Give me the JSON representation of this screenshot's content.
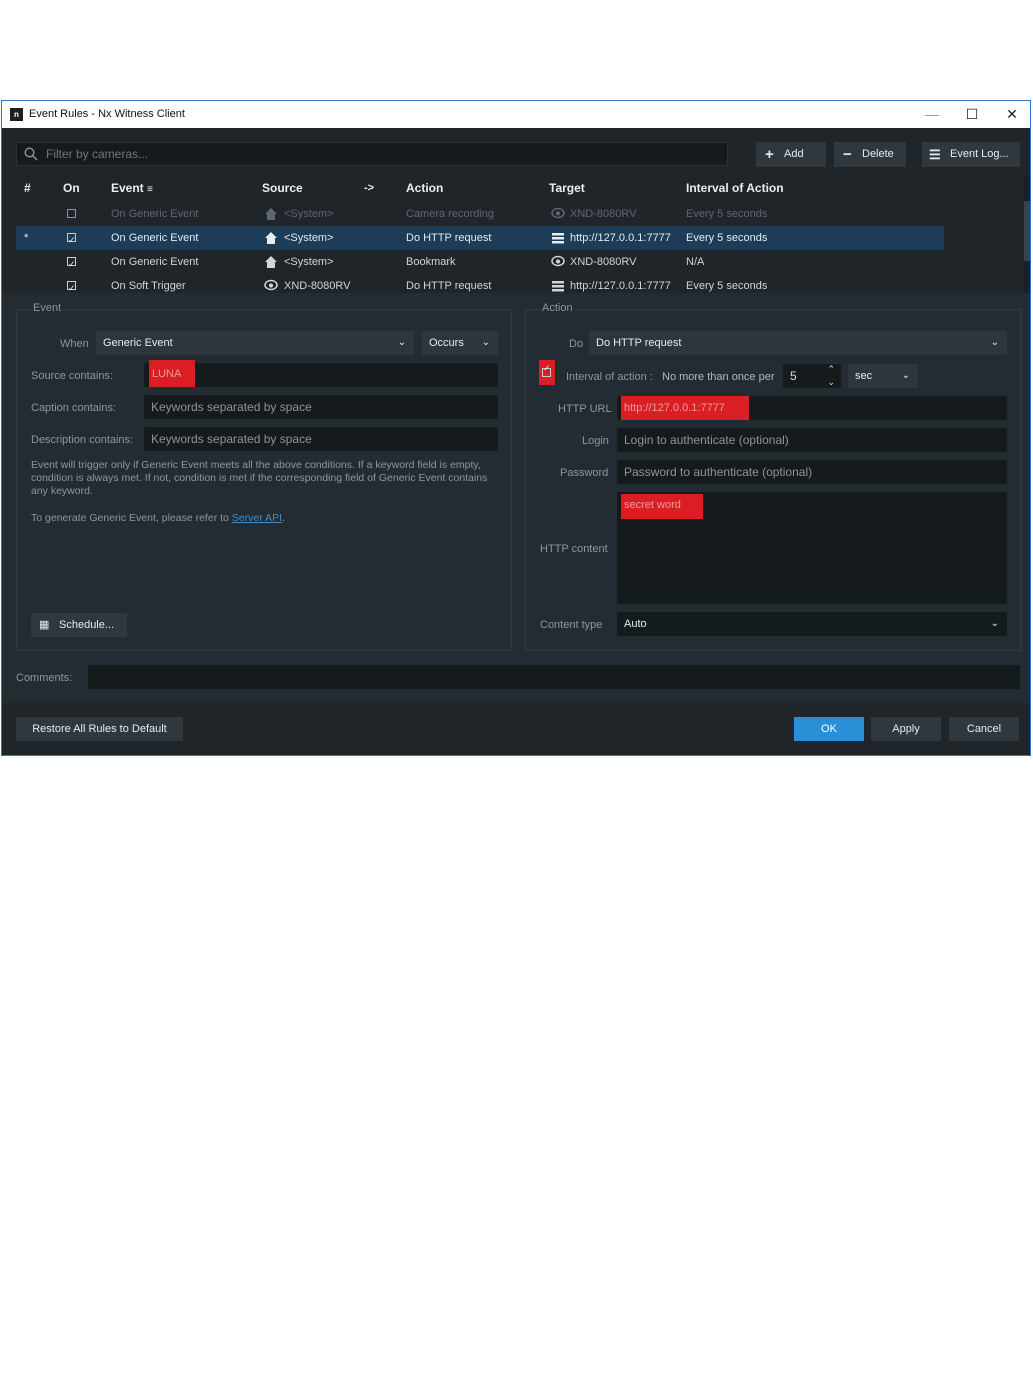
{
  "window": {
    "title": "Event Rules - Nx Witness Client",
    "app_icon_glyph": "n",
    "controls": {
      "minimize": "—",
      "maximize": "☐",
      "close": "✕"
    }
  },
  "toolbar": {
    "search_placeholder": "Filter by cameras...",
    "add_label": "Add",
    "delete_label": "Delete",
    "event_log_label": "Event Log..."
  },
  "table": {
    "headers": {
      "num": "#",
      "on": "On",
      "event": "Event",
      "source": "Source",
      "arrow": "->",
      "action": "Action",
      "target": "Target",
      "interval": "Interval of Action"
    },
    "rows": [
      {
        "num": "",
        "on": false,
        "event": "On Generic Event",
        "source": "<System>",
        "action": "Camera recording",
        "target": "XND-8080RV",
        "interval": "Every 5 seconds",
        "source_icon": "home-icon",
        "target_icon": "camera-icon"
      },
      {
        "num": "*",
        "on": true,
        "event": "On Generic Event",
        "source": "<System>",
        "action": "Do HTTP request",
        "target": "http://127.0.0.1:7777",
        "interval": "Every 5 seconds",
        "source_icon": "home-icon",
        "target_icon": "server-icon"
      },
      {
        "num": "",
        "on": true,
        "event": "On Generic Event",
        "source": "<System>",
        "action": "Bookmark",
        "target": "XND-8080RV",
        "interval": "N/A",
        "source_icon": "home-icon",
        "target_icon": "camera-icon"
      },
      {
        "num": "",
        "on": true,
        "event": "On Soft Trigger",
        "source": "XND-8080RV",
        "action": "Do HTTP request",
        "target": "http://127.0.0.1:7777",
        "interval": "Every 5 seconds",
        "source_icon": "camera-icon",
        "target_icon": "server-icon"
      }
    ]
  },
  "event_panel": {
    "title": "Event",
    "when_label": "When",
    "when_value": "Generic Event",
    "occurs_value": "Occurs",
    "source_label": "Source contains:",
    "source_value": "LUNA",
    "caption_label": "Caption contains:",
    "caption_placeholder": "Keywords separated by space",
    "description_label": "Description contains:",
    "description_placeholder": "Keywords separated by space",
    "note": "Event will trigger only if Generic Event meets all the above conditions. If a keyword field is empty, condition is always met. If not, condition is met if the corresponding field of Generic Event contains any keyword.",
    "refer_text": "To generate Generic Event, please refer to",
    "refer_link": "Server API",
    "refer_suffix": ".",
    "schedule_label": "Schedule..."
  },
  "action_panel": {
    "title": "Action",
    "do_label": "Do",
    "do_value": "Do HTTP request",
    "interval_label": "Interval of action :",
    "interval_desc": "No more than once per",
    "interval_value": "5",
    "interval_unit": "sec",
    "url_label": "HTTP URL",
    "url_value": "http://127.0.0.1:7777",
    "login_label": "Login",
    "login_placeholder": "Login to authenticate (optional)",
    "password_label": "Password",
    "password_placeholder": "Password to authenticate (optional)",
    "content_label": "HTTP content",
    "content_value": "secret word",
    "content_type_label": "Content type",
    "content_type_value": "Auto"
  },
  "comments_label": "Comments:",
  "footer": {
    "restore_label": "Restore All Rules to Default",
    "ok_label": "OK",
    "apply_label": "Apply",
    "cancel_label": "Cancel"
  },
  "colors": {
    "accent": "#2b8fd8",
    "window_border": "#2b78c4",
    "selection": "#1d3c57",
    "redaction": "#d91e24"
  }
}
